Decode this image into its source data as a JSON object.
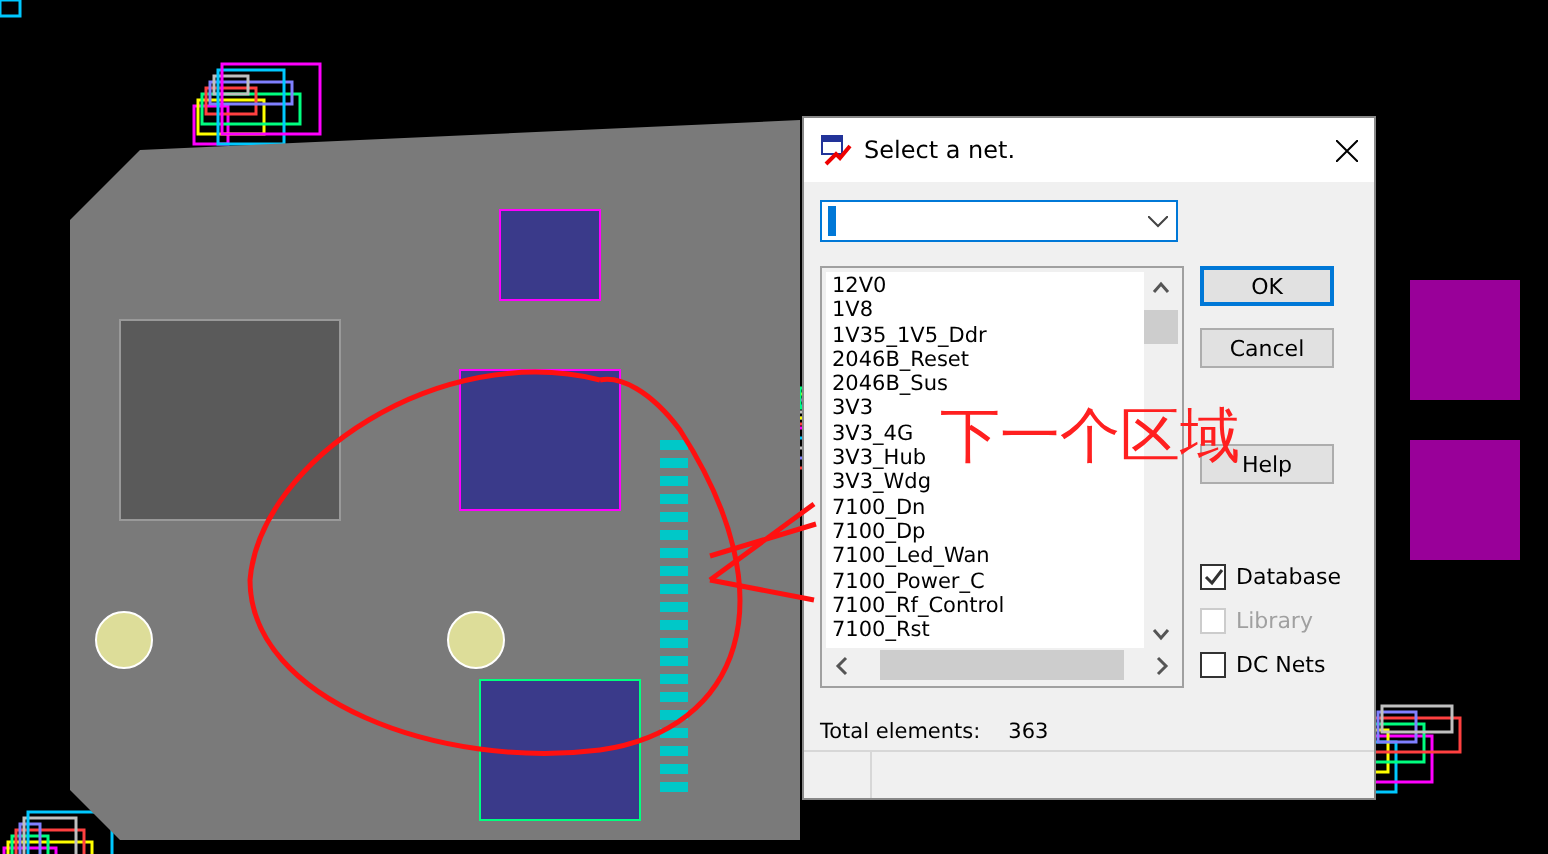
{
  "dialog": {
    "title": "Select a net.",
    "nets": [
      {
        "label": "12V0",
        "selected": false
      },
      {
        "label": "1V8",
        "selected": false
      },
      {
        "label": "1V35_1V5_Ddr",
        "selected": false
      },
      {
        "label": "2046B_Reset",
        "selected": false
      },
      {
        "label": "2046B_Sus",
        "selected": false
      },
      {
        "label": "3V3",
        "selected": false
      },
      {
        "label": "3V3_4G",
        "selected": false
      },
      {
        "label": "3V3_Hub",
        "selected": false
      },
      {
        "label": "3V3_Wdg",
        "selected": false
      },
      {
        "label": "7100_Dn",
        "selected": false
      },
      {
        "label": "7100_Dp",
        "selected": false
      },
      {
        "label": "7100_Led_Wan",
        "selected": false
      },
      {
        "label": "7100_Power_C",
        "selected": false
      },
      {
        "label": "7100_Rf_Control",
        "selected": false
      },
      {
        "label": "7100_Rst",
        "selected": false
      }
    ],
    "buttons": [
      {
        "label": "OK",
        "default": true
      },
      {
        "label": "Cancel",
        "default": false
      },
      {
        "label": "Help",
        "default": false
      }
    ],
    "options": [
      {
        "label": "Database",
        "checked": true,
        "disabled": false
      },
      {
        "label": "Library",
        "checked": false,
        "disabled": true
      },
      {
        "label": "DC Nets",
        "checked": false,
        "disabled": false
      }
    ],
    "total_label": "Total elements:",
    "total_value": "363"
  },
  "annotation": {
    "text": "下一个区域"
  }
}
